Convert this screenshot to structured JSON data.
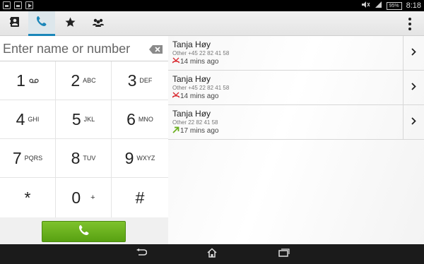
{
  "status_bar": {
    "battery": "95%",
    "time": "8:18",
    "icons": [
      "gallery-icon",
      "gallery-icon",
      "play-icon",
      "mute-icon",
      "signal-icon",
      "battery-icon"
    ]
  },
  "action_bar": {
    "tabs": [
      {
        "name": "contacts",
        "icon": "contacts-icon",
        "active": false
      },
      {
        "name": "phone",
        "icon": "phone-icon",
        "active": true
      },
      {
        "name": "favorites",
        "icon": "star-icon",
        "active": false
      },
      {
        "name": "groups",
        "icon": "groups-icon",
        "active": false
      }
    ],
    "overflow_icon": "overflow-menu-icon"
  },
  "dialer": {
    "input_placeholder": "Enter name or number",
    "input_value": "",
    "keys": [
      {
        "digit": "1",
        "letters": ""
      },
      {
        "digit": "2",
        "letters": "ABC"
      },
      {
        "digit": "3",
        "letters": "DEF"
      },
      {
        "digit": "4",
        "letters": "GHI"
      },
      {
        "digit": "5",
        "letters": "JKL"
      },
      {
        "digit": "6",
        "letters": "MNO"
      },
      {
        "digit": "7",
        "letters": "PQRS"
      },
      {
        "digit": "8",
        "letters": "TUV"
      },
      {
        "digit": "9",
        "letters": "WXYZ"
      },
      {
        "digit": "*",
        "letters": ""
      },
      {
        "digit": "0",
        "letters": "+"
      },
      {
        "digit": "#",
        "letters": ""
      }
    ],
    "call_icon": "phone-icon"
  },
  "call_log": [
    {
      "name": "Tanja Høy",
      "number": "Other +45 22 82 41 58",
      "time": "14 mins ago",
      "type": "missed",
      "type_color": "#d8232a"
    },
    {
      "name": "Tanja Høy",
      "number": "Other +45 22 82 41 58",
      "time": "14 mins ago",
      "type": "missed",
      "type_color": "#d8232a"
    },
    {
      "name": "Tanja Høy",
      "number": "Other 22 82 41 58",
      "time": "17 mins ago",
      "type": "outgoing",
      "type_color": "#6aaf1e"
    }
  ],
  "nav_bar": {
    "buttons": [
      "back-icon",
      "home-icon",
      "recent-apps-icon"
    ]
  },
  "colors": {
    "accent": "#1a86b9",
    "call_button": "#6ab31f",
    "missed": "#d8232a",
    "outgoing": "#6aaf1e"
  }
}
